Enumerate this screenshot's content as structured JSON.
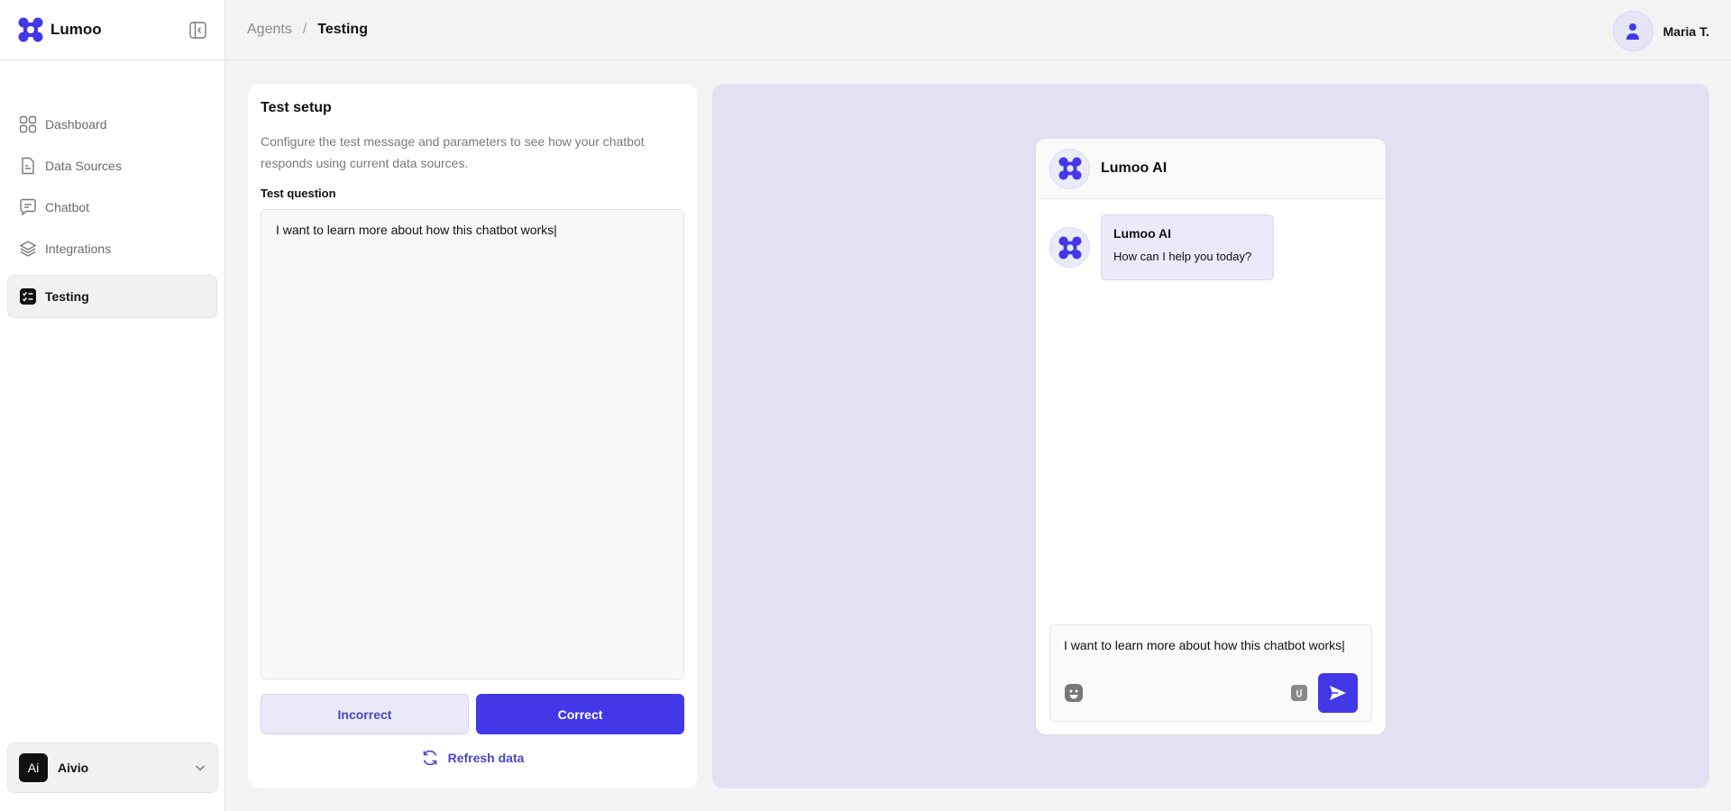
{
  "brand": {
    "name": "Lumoo",
    "accent": "#4238e8"
  },
  "sidebar": {
    "items": [
      {
        "label": "Dashboard",
        "icon": "dashboard-icon"
      },
      {
        "label": "Data Sources",
        "icon": "data-sources-icon"
      },
      {
        "label": "Chatbot",
        "icon": "chatbot-icon"
      },
      {
        "label": "Integrations",
        "icon": "layers-icon"
      },
      {
        "label": "Testing",
        "icon": "testing-icon",
        "active": true
      }
    ],
    "workspace": {
      "initials": "Ai",
      "name": "Aivio"
    }
  },
  "header": {
    "breadcrumb": {
      "parent": "Agents",
      "separator": "/",
      "current": "Testing"
    },
    "user": {
      "name": "Maria T."
    }
  },
  "setup": {
    "title": "Test setup",
    "description": "Configure the test message and parameters to see how your chatbot responds using current data sources.",
    "question_label": "Test question",
    "question_value": "I want to learn more about how this chatbot works|",
    "incorrect_label": "Incorrect",
    "correct_label": "Correct",
    "refresh_label": "Refresh data"
  },
  "chat": {
    "title": "Lumoo AI",
    "messages": [
      {
        "sender": "Lumoo AI",
        "text": "How can I help you today?"
      }
    ],
    "composer_value": "I want to learn more about how this chatbot works|"
  }
}
